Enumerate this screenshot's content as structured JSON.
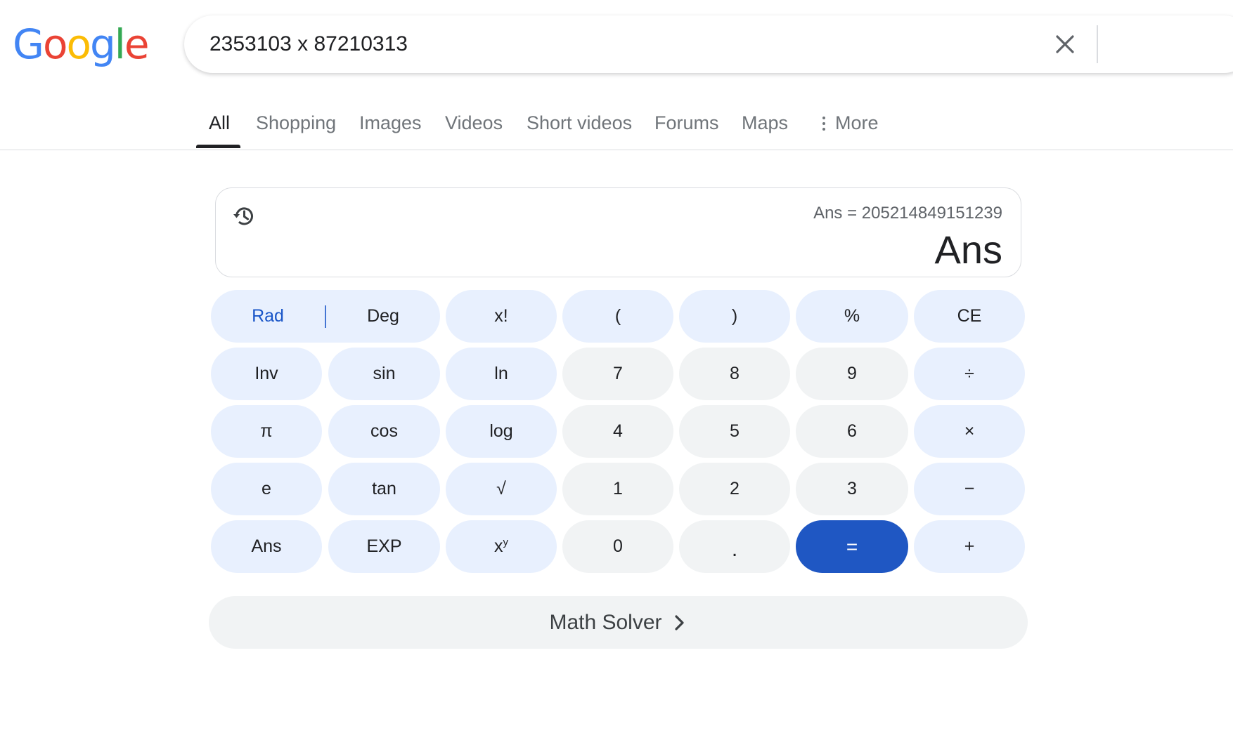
{
  "logo": {
    "letters": [
      {
        "ch": "G",
        "color": "#4285F4"
      },
      {
        "ch": "o",
        "color": "#EA4335"
      },
      {
        "ch": "o",
        "color": "#FBBC05"
      },
      {
        "ch": "g",
        "color": "#4285F4"
      },
      {
        "ch": "l",
        "color": "#34A853"
      },
      {
        "ch": "e",
        "color": "#EA4335"
      }
    ]
  },
  "search": {
    "query": "2353103 x 87210313",
    "clear_icon": "close-icon"
  },
  "tabs": [
    {
      "label": "All",
      "active": true
    },
    {
      "label": "Shopping",
      "active": false
    },
    {
      "label": "Images",
      "active": false
    },
    {
      "label": "Videos",
      "active": false
    },
    {
      "label": "Short videos",
      "active": false
    },
    {
      "label": "Forums",
      "active": false
    },
    {
      "label": "Maps",
      "active": false
    },
    {
      "label": "More",
      "active": false,
      "icon": "vertical-dots-icon"
    }
  ],
  "calculator": {
    "history_icon": "history-icon",
    "previous_expression": "Ans = 205214849151239",
    "result": "Ans",
    "keys": {
      "rad": "Rad",
      "deg": "Deg",
      "fact": "x!",
      "lparen": "(",
      "rparen": ")",
      "percent": "%",
      "ce": "CE",
      "inv": "Inv",
      "sin": "sin",
      "ln": "ln",
      "d7": "7",
      "d8": "8",
      "d9": "9",
      "div": "÷",
      "pi": "π",
      "cos": "cos",
      "log": "log",
      "d4": "4",
      "d5": "5",
      "d6": "6",
      "mul": "×",
      "e": "e",
      "tan": "tan",
      "sqrt": "√",
      "d1": "1",
      "d2": "2",
      "d3": "3",
      "minus": "−",
      "ans": "Ans",
      "exp": "EXP",
      "pow_base": "x",
      "pow_exp": "y",
      "d0": "0",
      "dot": ".",
      "eq": "=",
      "plus": "+"
    },
    "math_solver": "Math Solver",
    "colors": {
      "function_key": "#e8f0fe",
      "number_key": "#f1f3f4",
      "equals_key": "#1f57c3",
      "rad_active": "#1a56c8"
    }
  }
}
